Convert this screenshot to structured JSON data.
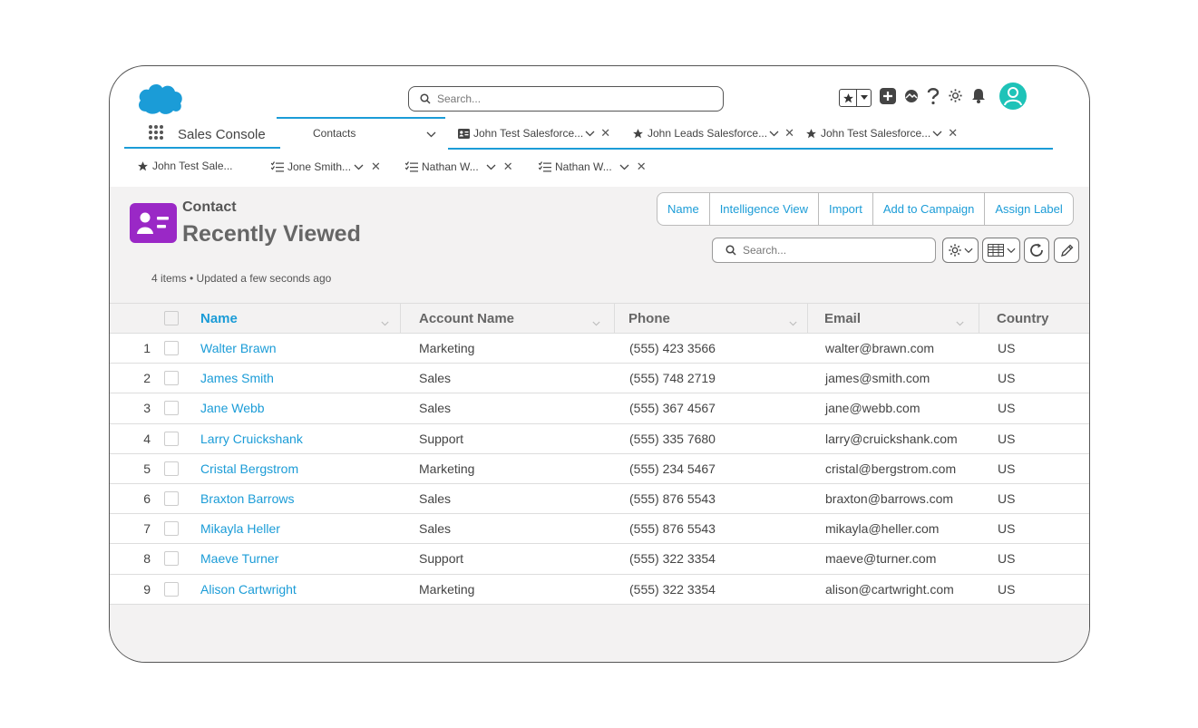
{
  "header": {
    "search_placeholder": "Search..."
  },
  "app_nav": {
    "app_name": "Sales Console",
    "object_tab": "Contacts",
    "workspace_tabs": [
      {
        "label": "John Test Salesforce...",
        "icon": "contact-card-icon"
      },
      {
        "label": "John Leads Salesforce...",
        "icon": "star-icon"
      },
      {
        "label": "John Test Salesforce...",
        "icon": "star-icon"
      }
    ],
    "subtabs": [
      {
        "label": "John Test Sale...",
        "icon": "star-icon"
      },
      {
        "label": "Jone Smith...",
        "icon": "checklist-icon"
      },
      {
        "label": "Nathan W...",
        "icon": "checklist-icon"
      },
      {
        "label": "Nathan W...",
        "icon": "checklist-icon"
      }
    ]
  },
  "list_view": {
    "object_type": "Contact",
    "title": "Recently Viewed",
    "meta": "4 items • Updated a few seconds ago",
    "actions": [
      "Name",
      "Intelligence View",
      "Import",
      "Add to Campaign",
      "Assign Label"
    ],
    "search_placeholder": "Search..."
  },
  "table": {
    "columns": [
      "Name",
      "Account Name",
      "Phone",
      "Email",
      "Country"
    ],
    "rows": [
      {
        "num": "1",
        "name": "Walter Brawn",
        "account": "Marketing",
        "phone": "(555) 423 3566",
        "email": "walter@brawn.com",
        "country": "US"
      },
      {
        "num": "2",
        "name": "James Smith",
        "account": "Sales",
        "phone": "(555) 748 2719",
        "email": "james@smith.com",
        "country": "US"
      },
      {
        "num": "3",
        "name": "Jane Webb",
        "account": "Sales",
        "phone": "(555) 367 4567",
        "email": "jane@webb.com",
        "country": "US"
      },
      {
        "num": "4",
        "name": "Larry Cruickshank",
        "account": "Support",
        "phone": "(555) 335 7680",
        "email": "larry@cruickshank.com",
        "country": "US"
      },
      {
        "num": "5",
        "name": "Cristal Bergstrom",
        "account": "Marketing",
        "phone": "(555) 234 5467",
        "email": "cristal@bergstrom.com",
        "country": "US"
      },
      {
        "num": "6",
        "name": "Braxton Barrows",
        "account": "Sales",
        "phone": "(555) 876 5543",
        "email": "braxton@barrows.com",
        "country": "US"
      },
      {
        "num": "7",
        "name": "Mikayla Heller",
        "account": "Sales",
        "phone": "(555) 876 5543",
        "email": "mikayla@heller.com",
        "country": "US"
      },
      {
        "num": "8",
        "name": "Maeve Turner",
        "account": "Support",
        "phone": "(555) 322 3354",
        "email": "maeve@turner.com",
        "country": "US"
      },
      {
        "num": "9",
        "name": "Alison Cartwright",
        "account": "Marketing",
        "phone": "(555) 322 3354",
        "email": "alison@cartwright.com",
        "country": "US"
      }
    ]
  },
  "colors": {
    "accent": "#1b9cd7",
    "object_icon": "#9a28c6",
    "avatar": "#1ec3b8",
    "cloud_logo": "#1b9cd7"
  }
}
